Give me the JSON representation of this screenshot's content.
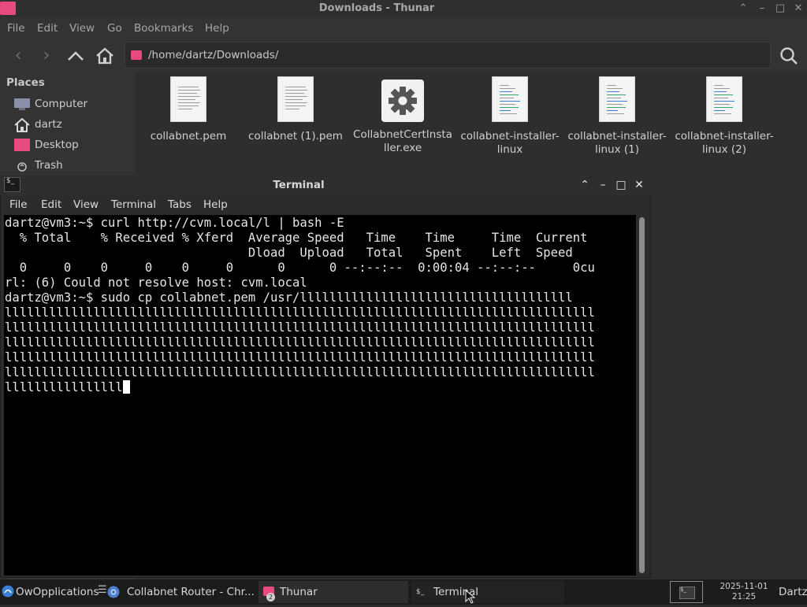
{
  "thunar": {
    "title": "Downloads - Thunar",
    "menu": [
      "File",
      "Edit",
      "View",
      "Go",
      "Bookmarks",
      "Help"
    ],
    "location": "/home/dartz/Downloads/",
    "places_heading": "Places",
    "places": [
      "Computer",
      "dartz",
      "Desktop",
      "Trash"
    ],
    "files": [
      {
        "label": "collabnet.pem",
        "icon": "text-document-icon"
      },
      {
        "label": "collabnet (1).pem",
        "icon": "text-document-icon"
      },
      {
        "label": "CollabnetCertInstaller.exe",
        "icon": "gear-executable-icon"
      },
      {
        "label": "collabnet-installer-linux",
        "icon": "script-document-icon"
      },
      {
        "label": "collabnet-installer-linux (1)",
        "icon": "script-document-icon"
      },
      {
        "label": "collabnet-installer-linux (2)",
        "icon": "script-document-icon"
      }
    ]
  },
  "terminal": {
    "title": "Terminal",
    "menu": [
      "File",
      "Edit",
      "View",
      "Terminal",
      "Tabs",
      "Help"
    ],
    "lines": [
      "dartz@vm3:~$ curl http://cvm.local/l | bash -E",
      "  % Total    % Received % Xferd  Average Speed   Time    Time     Time  Current",
      "                                 Dload  Upload   Total   Spent    Left  Speed",
      "  0     0    0     0    0     0      0      0 --:--:--  0:00:04 --:--:--     0cu",
      "rl: (6) Could not resolve host: cvm.local",
      "dartz@vm3:~$ sudo cp collabnet.pem /usr/lllllllllllllllllllllllllllllllllllll",
      "llllllllllllllllllllllllllllllllllllllllllllllllllllllllllllllllllllllllllllllll",
      "llllllllllllllllllllllllllllllllllllllllllllllllllllllllllllllllllllllllllllllll",
      "llllllllllllllllllllllllllllllllllllllllllllllllllllllllllllllllllllllllllllllll",
      "llllllllllllllllllllllllllllllllllllllllllllllllllllllllllllllllllllllllllllllll",
      "llllllllllllllllllllllllllllllllllllllllllllllllllllllllllllllllllllllllllllllll",
      "llllllllllllllll"
    ]
  },
  "taskbar": {
    "start_label": "OwOpplications",
    "tasks": [
      {
        "label": "Collabnet Router - Chr..."
      },
      {
        "label": "Thunar",
        "badge": "2"
      },
      {
        "label": "Terminal"
      }
    ],
    "clock_date": "2025-11-01",
    "clock_time": "21:25",
    "user": "Dartz"
  },
  "colors": {
    "accent_pink": "#e84a7f",
    "terminal_bg": "#000000",
    "window_bg": "#333333"
  }
}
